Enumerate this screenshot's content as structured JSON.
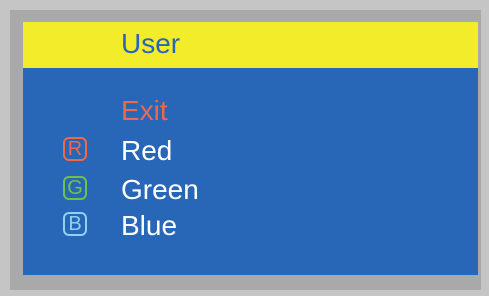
{
  "menu": {
    "title": "User",
    "items": [
      {
        "label": "Exit",
        "badge": ""
      },
      {
        "label": "Red",
        "badge": "R"
      },
      {
        "label": "Green",
        "badge": "G"
      },
      {
        "label": "Blue",
        "badge": "B"
      }
    ]
  },
  "colors": {
    "background": "#2866b7",
    "header": "#f2ec2a",
    "exit": "#ef6848",
    "red_badge": "#ef6848",
    "green_badge": "#6ec24a",
    "blue_badge": "#8fd1f5"
  }
}
